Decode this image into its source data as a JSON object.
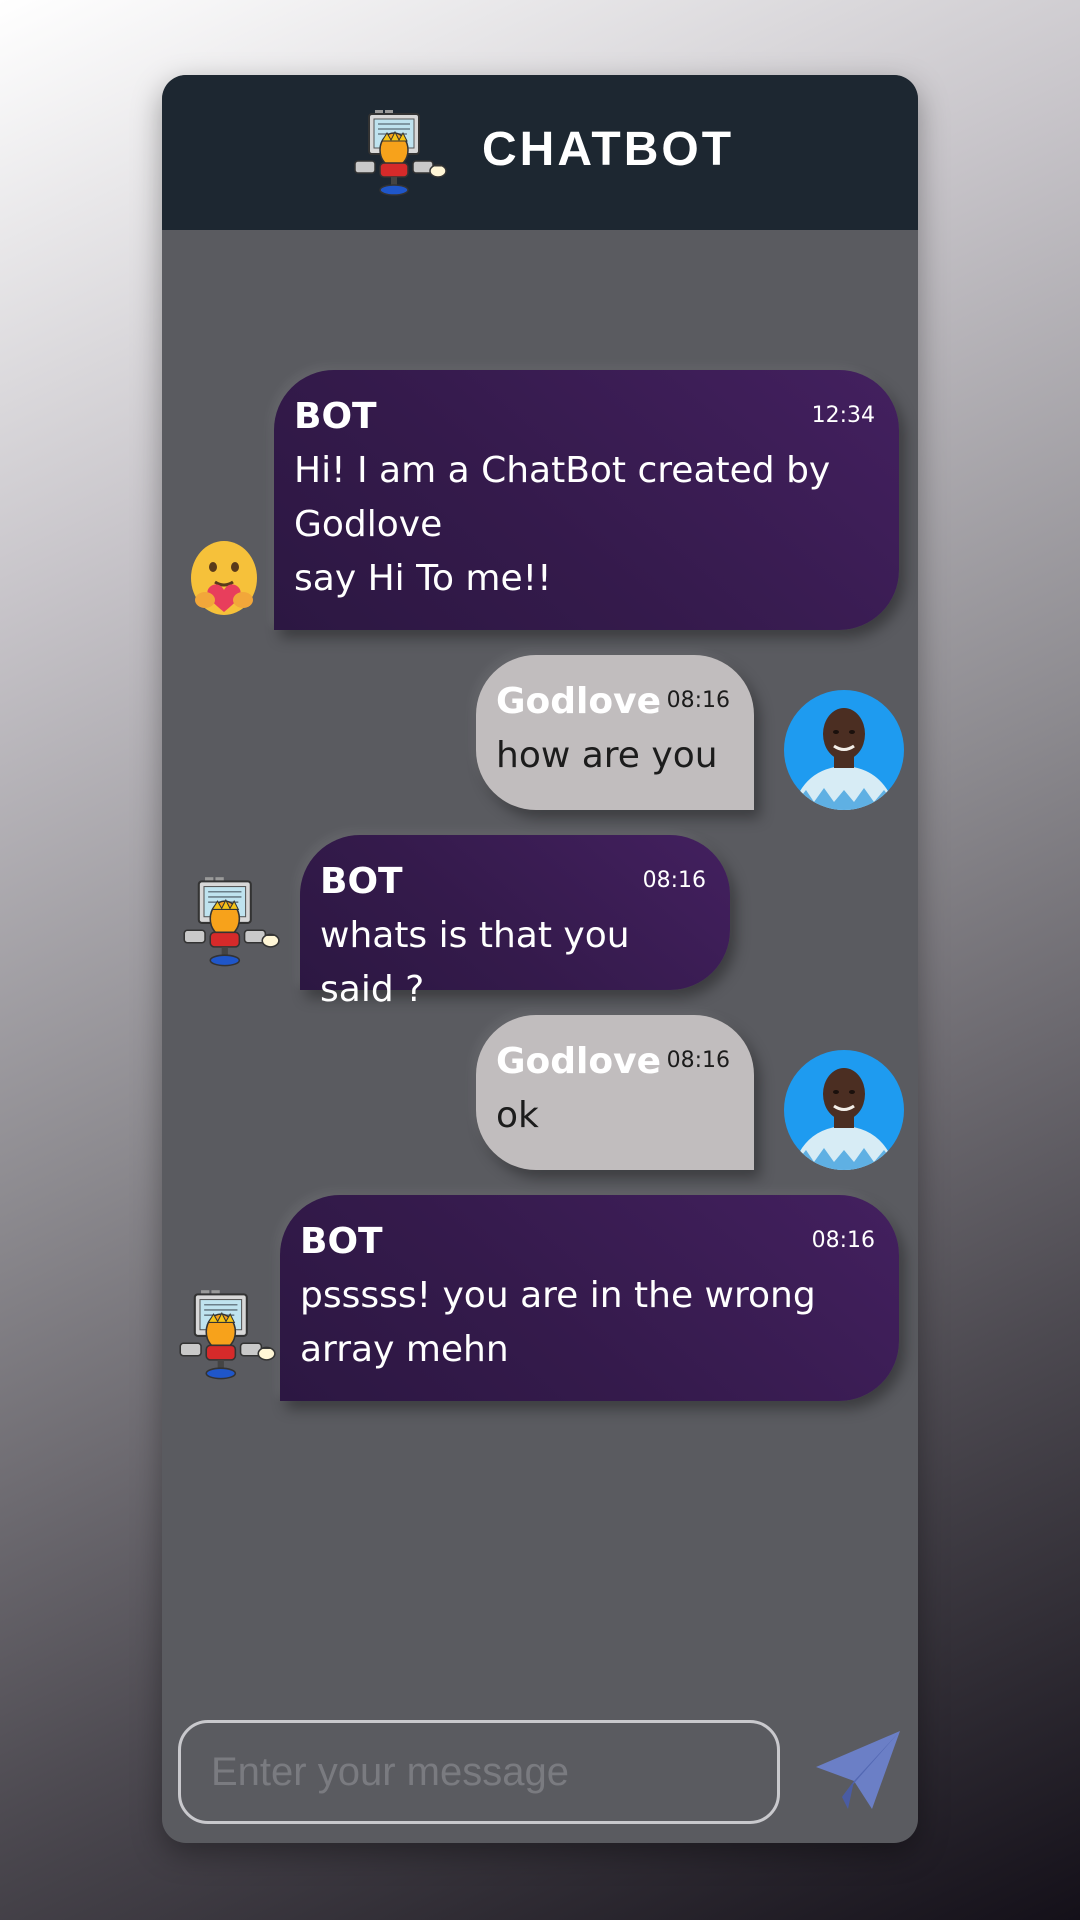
{
  "header": {
    "title": "CHATBOT",
    "logo_icon": "robot-computer-icon"
  },
  "messages": [
    {
      "sender": "BOT",
      "time": "12:34",
      "text": "Hi! I am a ChatBot created by\nGodlove\nsay Hi To me!!",
      "avatar": "hugging-emoji-icon"
    },
    {
      "sender": "Godlove",
      "time": "08:16",
      "text": "how are you",
      "avatar": "user-photo"
    },
    {
      "sender": "BOT",
      "time": "08:16",
      "text": "whats is that you said ?",
      "avatar": "robot-computer-icon"
    },
    {
      "sender": "Godlove",
      "time": "08:16",
      "text": "ok",
      "avatar": "user-photo"
    },
    {
      "sender": "BOT",
      "time": "08:16",
      "text": "psssss! you are in the wrong\narray mehn",
      "avatar": "robot-computer-icon"
    }
  ],
  "input": {
    "placeholder": "Enter your message",
    "value": ""
  },
  "send_icon": "paper-plane-icon",
  "colors": {
    "header_bg": "#1d2731",
    "chat_bg": "#5a5b60",
    "bot_bubble": "#3b1c55",
    "user_bubble": "#c1bdbe",
    "avatar_bg": "#1e9bf0",
    "send_icon": "#6b7fc6"
  }
}
